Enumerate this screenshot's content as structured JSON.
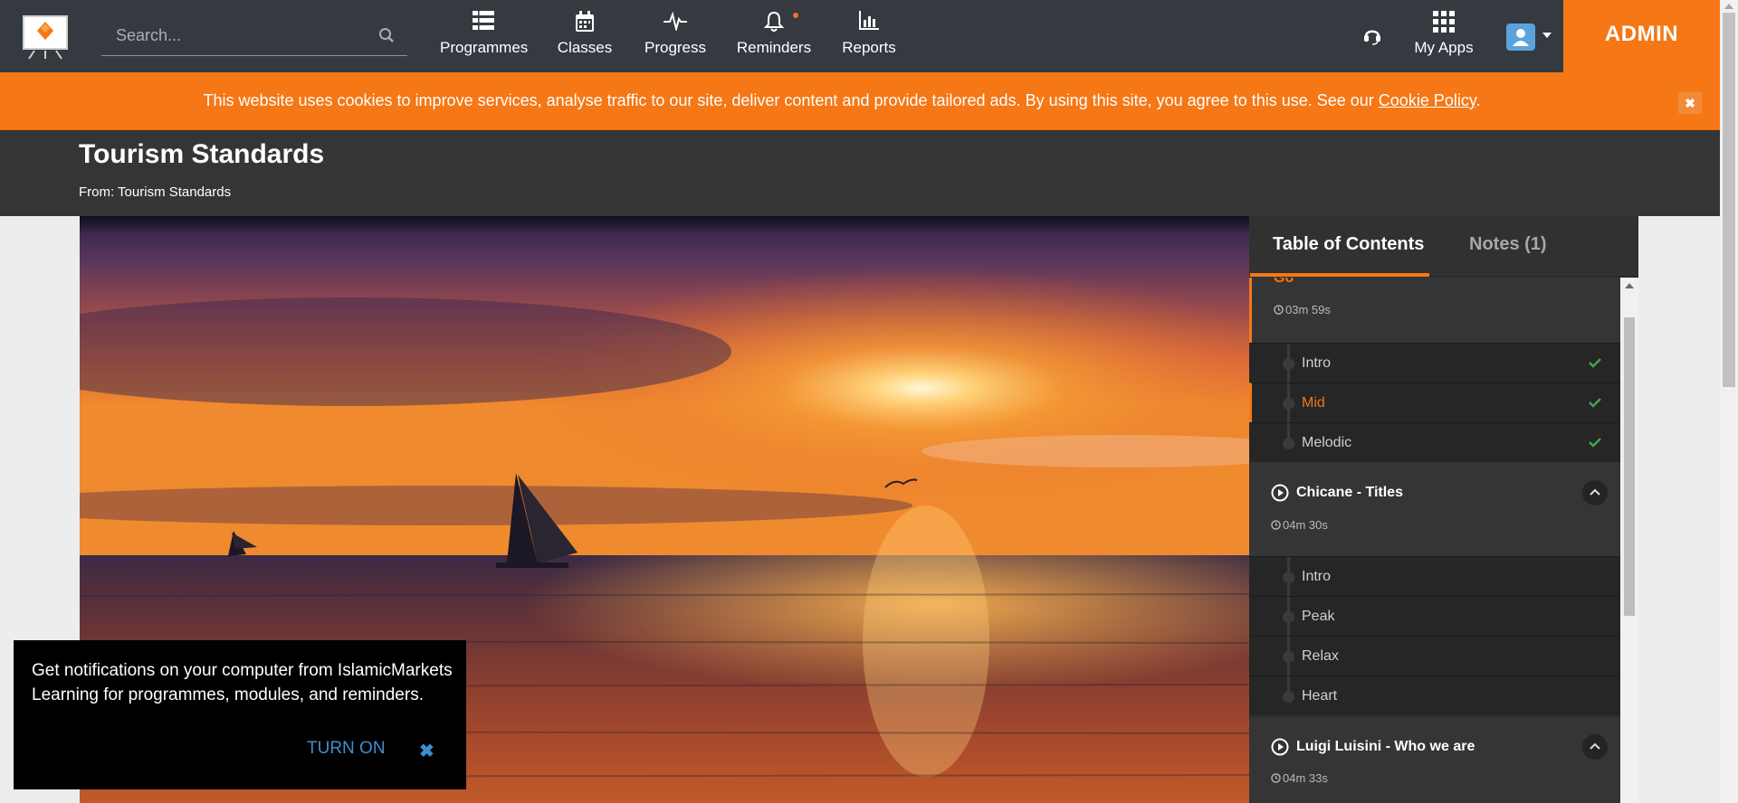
{
  "navbar": {
    "search_placeholder": "Search...",
    "items": [
      {
        "label": "Programmes",
        "icon": "list-icon"
      },
      {
        "label": "Classes",
        "icon": "calendar-icon"
      },
      {
        "label": "Progress",
        "icon": "pulse-icon"
      },
      {
        "label": "Reminders",
        "icon": "bell-icon"
      },
      {
        "label": "Reports",
        "icon": "bar-chart-icon"
      }
    ],
    "my_apps": "My Apps",
    "admin": "ADMIN",
    "accent": "#f57716"
  },
  "cookie": {
    "message": "This website uses cookies to improve services, analyse traffic to our site, deliver content and provide tailored ads. By using this site, you agree to this use. See our ",
    "link": "Cookie Policy",
    "suffix": ".",
    "close": "✖"
  },
  "header": {
    "title": "Tourism Standards",
    "from": "From: Tourism Standards"
  },
  "toc": {
    "tab_contents": "Table of Contents",
    "tab_notes": "Notes (1)",
    "sections": [
      {
        "title": "Go",
        "duration": "03m 59s",
        "lessons": [
          {
            "name": "Intro",
            "done": true
          },
          {
            "name": "Mid",
            "done": true,
            "current": true
          },
          {
            "name": "Melodic",
            "done": true
          }
        ]
      },
      {
        "title": "Chicane - Titles",
        "duration": "04m 30s",
        "lessons": [
          {
            "name": "Intro"
          },
          {
            "name": "Peak"
          },
          {
            "name": "Relax"
          },
          {
            "name": "Heart"
          }
        ]
      },
      {
        "title": "Luigi Luisini - Who we are",
        "duration": "04m 33s",
        "lessons": []
      }
    ]
  },
  "notification": {
    "text": "Get notifications on your computer from IslamicMarkets Learning for programmes, modules, and reminders.",
    "turn_on": "TURN ON",
    "close": "✖"
  }
}
